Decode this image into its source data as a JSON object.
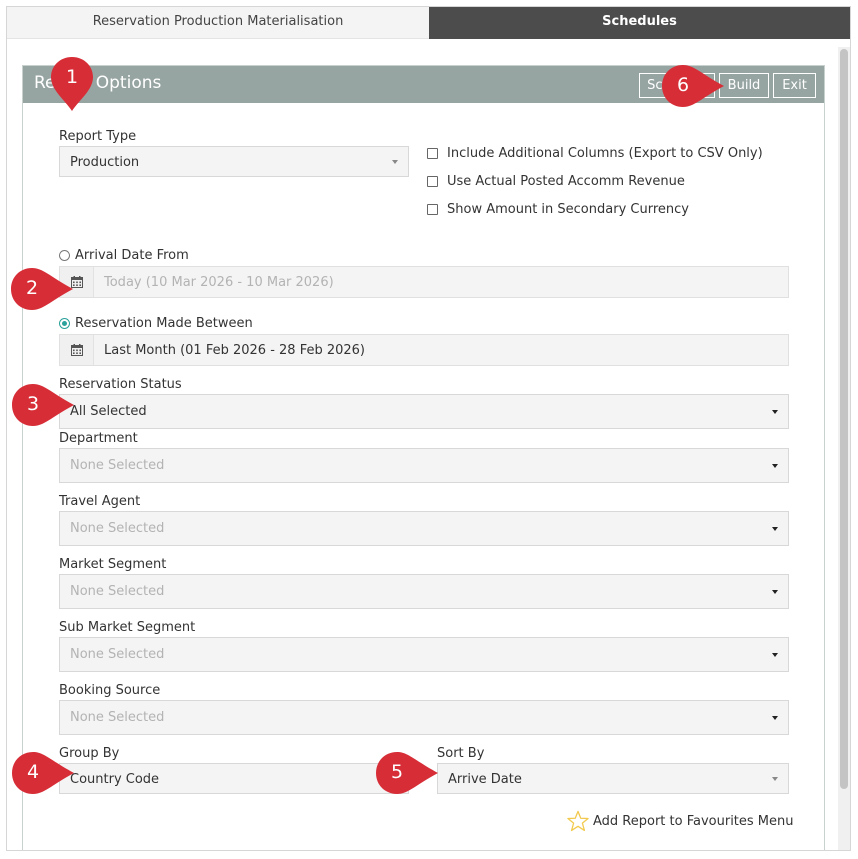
{
  "tabs": [
    {
      "label": "Reservation Production Materialisation",
      "active": true
    },
    {
      "label": "Schedules",
      "active": false
    }
  ],
  "panel": {
    "title": "Report Options",
    "buttons": {
      "schedule": "Schedule",
      "build": "Build",
      "exit": "Exit"
    }
  },
  "report_type": {
    "label": "Report Type",
    "value": "Production"
  },
  "options": [
    {
      "label": "Include Additional Columns (Export to CSV Only)",
      "checked": false
    },
    {
      "label": "Use Actual Posted Accomm Revenue",
      "checked": false
    },
    {
      "label": "Show Amount in Secondary Currency",
      "checked": false
    }
  ],
  "arrival_date": {
    "label": "Arrival Date From",
    "selected": false,
    "value": "Today (10 Mar 2026 - 10 Mar 2026)"
  },
  "reservation_made": {
    "label": "Reservation Made Between",
    "selected": true,
    "value": "Last Month (01 Feb 2026 - 28 Feb 2026)"
  },
  "reservation_status": {
    "label": "Reservation Status",
    "value": "All Selected"
  },
  "department": {
    "label": "Department",
    "value": "None Selected"
  },
  "travel_agent": {
    "label": "Travel Agent",
    "value": "None Selected"
  },
  "market_segment": {
    "label": "Market Segment",
    "value": "None Selected"
  },
  "sub_market_segment": {
    "label": "Sub Market Segment",
    "value": "None Selected"
  },
  "booking_source": {
    "label": "Booking Source",
    "value": "None Selected"
  },
  "group_by": {
    "label": "Group By",
    "value": "Country Code"
  },
  "sort_by": {
    "label": "Sort By",
    "value": "Arrive Date"
  },
  "favourites": {
    "label": "Add Report to Favourites Menu"
  },
  "markers": [
    "1",
    "2",
    "3",
    "4",
    "5",
    "6"
  ],
  "colors": {
    "tab_inactive": "#4c4c4c",
    "panel_header": "#97a5a2",
    "marker": "#d72d37",
    "radio_selected": "#2aa19a",
    "star": "#f2c94c"
  },
  "icons": [
    "calendar-icon",
    "star-icon",
    "chevron-down-icon",
    "marker-pin-icon"
  ]
}
